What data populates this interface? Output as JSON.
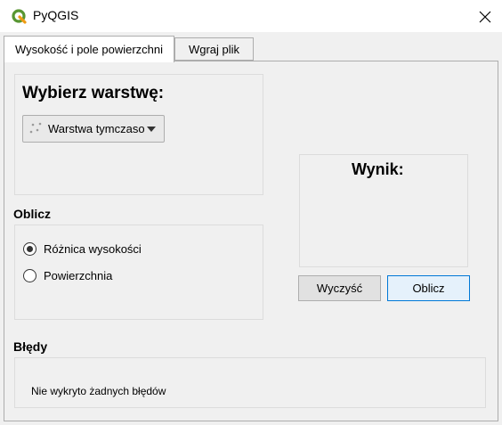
{
  "window": {
    "title": "PyQGIS",
    "app_icon": "qgis-icon",
    "close_icon": "close-icon"
  },
  "tabs": [
    {
      "label": "Wysokość i pole powierzchni",
      "active": true
    },
    {
      "label": "Wgraj plik",
      "active": false
    }
  ],
  "layer_section": {
    "heading": "Wybierz warstwę:",
    "combo_value": "Warstwa tymczasowa",
    "combo_icon": "point-layer-icon"
  },
  "calculate_section": {
    "heading": "Oblicz",
    "options": [
      {
        "label": "Różnica wysokości",
        "checked": true
      },
      {
        "label": "Powierzchnia",
        "checked": false
      }
    ]
  },
  "result_section": {
    "heading": "Wynik:",
    "value": ""
  },
  "buttons": {
    "clear_label": "Wyczyść",
    "calculate_label": "Oblicz"
  },
  "errors_section": {
    "heading": "Błędy",
    "message": "Nie wykryto żadnych błędów"
  },
  "colors": {
    "qgis_green": "#589632",
    "qgis_yellow": "#ee7913",
    "default_button_border": "#0078d7"
  }
}
